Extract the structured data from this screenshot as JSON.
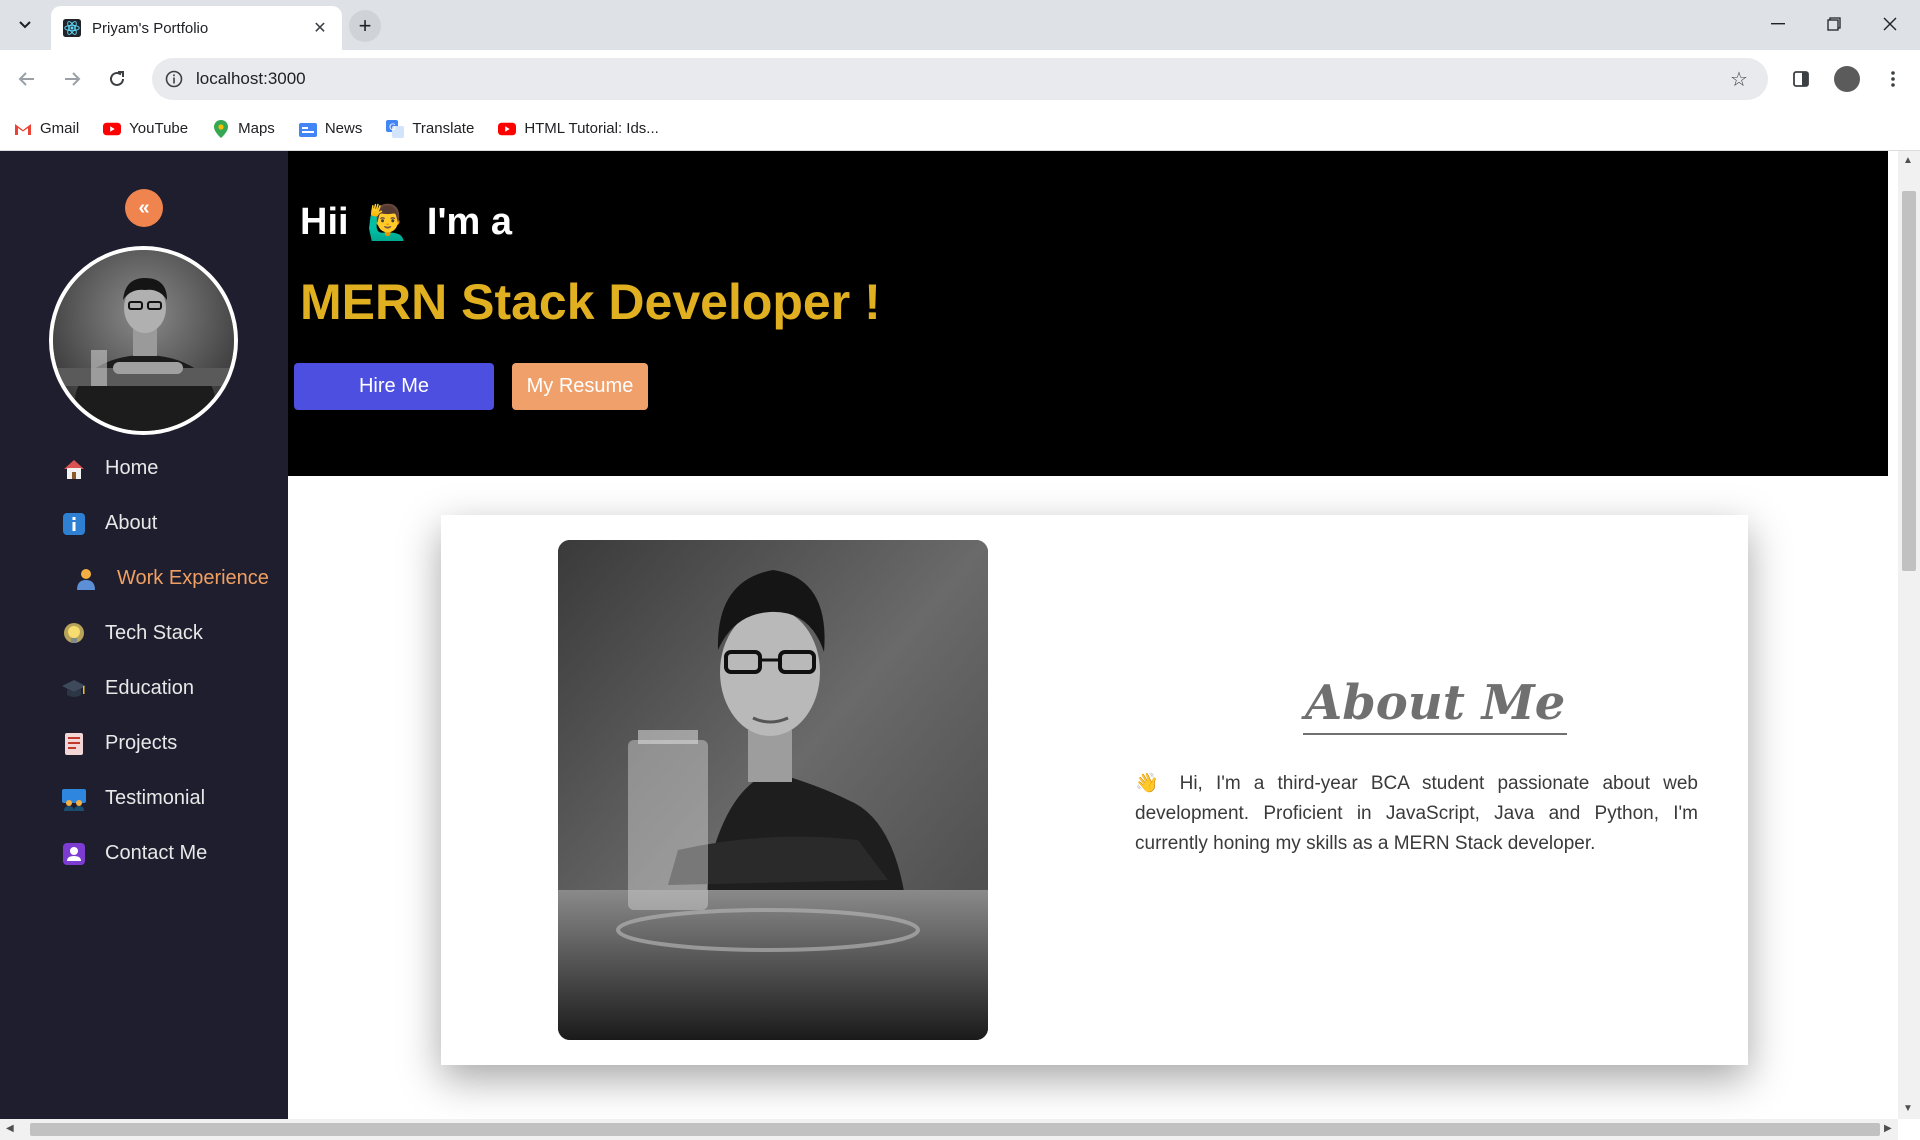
{
  "browser": {
    "tab_title": "Priyam's Portfolio",
    "url": "localhost:3000",
    "bookmarks": [
      {
        "label": "Gmail",
        "icon": "gmail-icon"
      },
      {
        "label": "YouTube",
        "icon": "youtube-icon"
      },
      {
        "label": "Maps",
        "icon": "maps-icon"
      },
      {
        "label": "News",
        "icon": "news-icon"
      },
      {
        "label": "Translate",
        "icon": "translate-icon"
      },
      {
        "label": "HTML Tutorial: Ids...",
        "icon": "youtube-icon"
      }
    ]
  },
  "sidebar": {
    "collapse_icon": "«",
    "items": [
      {
        "label": "Home",
        "icon": "home-icon"
      },
      {
        "label": "About",
        "icon": "info-icon"
      },
      {
        "label": "Work Experience",
        "icon": "worker-icon",
        "active": true
      },
      {
        "label": "Tech Stack",
        "icon": "lightbulb-icon"
      },
      {
        "label": "Education",
        "icon": "graduation-cap-icon"
      },
      {
        "label": "Projects",
        "icon": "document-icon"
      },
      {
        "label": "Testimonial",
        "icon": "people-icon"
      },
      {
        "label": "Contact Me",
        "icon": "contact-icon"
      }
    ]
  },
  "hero": {
    "greeting_start": "Hii",
    "greeting_emoji": "🙋‍♂️",
    "greeting_end": "I'm a",
    "role": "MERN Stack Developer !",
    "hire_button": "Hire Me",
    "resume_button": "My Resume"
  },
  "about": {
    "title": "About Me",
    "text": "👋  Hi, I'm a third-year BCA student passionate about web development. Proficient in JavaScript, Java and Python, I'm currently honing my skills as a MERN Stack developer."
  },
  "colors": {
    "sidebar_bg": "#1e1e2e",
    "accent_orange": "#f0844e",
    "active_nav": "#f0a062",
    "role_gold": "#e0b020",
    "hire_blue": "#4c4fe0",
    "resume_orange": "#f0a06a"
  }
}
